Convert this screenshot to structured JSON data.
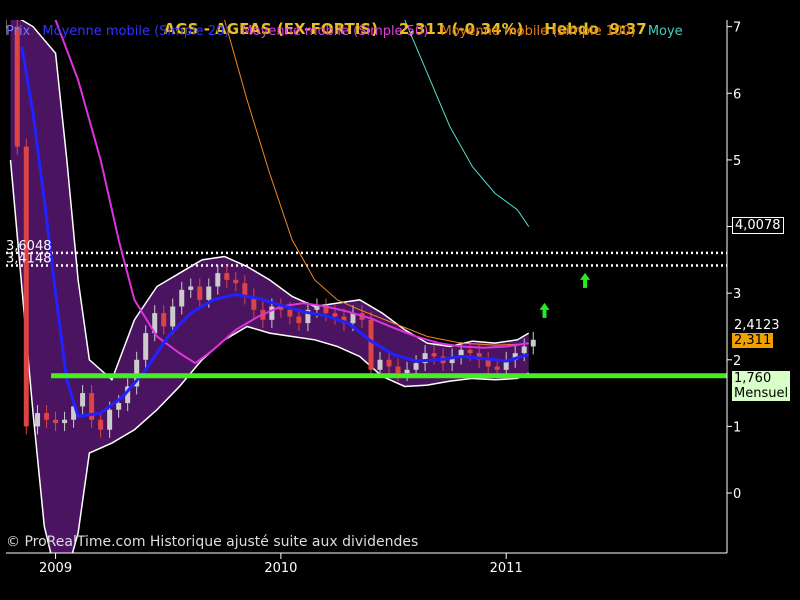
{
  "header": {
    "ticker": "AGS - AGEAS (EX-FORTIS)",
    "quote": "2,311 (-0,34%)",
    "period": "Hebdo",
    "time": "9:37"
  },
  "legend": [
    {
      "label": "Prix",
      "color": "#7777ff"
    },
    {
      "label": "Moyenne mobile (Simple 20)",
      "color": "#3333ff"
    },
    {
      "label": "Moyenne mobile (Simple 50)",
      "color": "#e040e0"
    },
    {
      "label": "Moyenne mobile (Simple 100)",
      "color": "#e08020"
    },
    {
      "label": "Moye",
      "color": "#40d0c0"
    }
  ],
  "footer": "© ProRealTime.com Historique ajusté suite aux dividendes",
  "colors": {
    "background": "#000000",
    "band_fill": "#4a1460",
    "band_edge": "#ffffff",
    "sma20": "#2222ff",
    "sma50": "#dd33dd",
    "sma100": "#ee8822",
    "sma200": "#55ddcc",
    "sma_dashed": "#44cccc",
    "support": "#44ee22",
    "arrow": "#22ee22",
    "up_candle": "#cccccc",
    "down_candle": "#dd4444",
    "price_tag": "#f0a000",
    "support_tag": "#d8ffc8"
  },
  "chart_data": {
    "type": "candlestick",
    "title": "AGS - AGEAS (EX-FORTIS)",
    "ylim": [
      -0.9,
      7.1
    ],
    "y_ticks": [
      "0",
      "1",
      "2",
      "3",
      "4",
      "5",
      "6",
      "7"
    ],
    "x_ticks": [
      "2009",
      "2010",
      "2011"
    ],
    "x_range": [
      "2008-10",
      "2011-12"
    ],
    "horizontal_levels": [
      {
        "value": 3.6048,
        "label": "3,6048",
        "style": "dotted"
      },
      {
        "value": 3.4148,
        "label": "3,4148",
        "style": "dotted"
      }
    ],
    "support": {
      "value": 1.76,
      "label": "1,760",
      "sublabel": "Mensuel"
    },
    "price_tags": [
      {
        "value": 4.0078,
        "label": "4,0078"
      },
      {
        "value": 2.311,
        "label": "2,311"
      },
      {
        "value": 2.4123,
        "label": "2,4123"
      }
    ],
    "closes": [
      [
        2008.78,
        7.0
      ],
      [
        2008.83,
        5.2
      ],
      [
        2008.87,
        1.0
      ],
      [
        2008.92,
        1.2
      ],
      [
        2008.96,
        1.1
      ],
      [
        2009.0,
        1.05
      ],
      [
        2009.04,
        1.1
      ],
      [
        2009.08,
        1.3
      ],
      [
        2009.12,
        1.5
      ],
      [
        2009.16,
        1.1
      ],
      [
        2009.2,
        0.95
      ],
      [
        2009.24,
        1.25
      ],
      [
        2009.28,
        1.35
      ],
      [
        2009.32,
        1.6
      ],
      [
        2009.36,
        2.0
      ],
      [
        2009.4,
        2.4
      ],
      [
        2009.44,
        2.7
      ],
      [
        2009.48,
        2.5
      ],
      [
        2009.52,
        2.8
      ],
      [
        2009.56,
        3.05
      ],
      [
        2009.6,
        3.1
      ],
      [
        2009.64,
        2.9
      ],
      [
        2009.68,
        3.1
      ],
      [
        2009.72,
        3.3
      ],
      [
        2009.76,
        3.2
      ],
      [
        2009.8,
        3.15
      ],
      [
        2009.84,
        2.95
      ],
      [
        2009.88,
        2.75
      ],
      [
        2009.92,
        2.6
      ],
      [
        2009.96,
        2.8
      ],
      [
        2010.0,
        2.75
      ],
      [
        2010.04,
        2.65
      ],
      [
        2010.08,
        2.55
      ],
      [
        2010.12,
        2.75
      ],
      [
        2010.16,
        2.8
      ],
      [
        2010.2,
        2.7
      ],
      [
        2010.24,
        2.65
      ],
      [
        2010.28,
        2.55
      ],
      [
        2010.32,
        2.7
      ],
      [
        2010.36,
        2.6
      ],
      [
        2010.4,
        1.85
      ],
      [
        2010.44,
        2.0
      ],
      [
        2010.48,
        1.9
      ],
      [
        2010.52,
        1.8
      ],
      [
        2010.56,
        1.85
      ],
      [
        2010.6,
        1.95
      ],
      [
        2010.64,
        2.1
      ],
      [
        2010.68,
        2.05
      ],
      [
        2010.72,
        1.95
      ],
      [
        2010.76,
        2.05
      ],
      [
        2010.8,
        2.15
      ],
      [
        2010.84,
        2.1
      ],
      [
        2010.88,
        2.0
      ],
      [
        2010.92,
        1.9
      ],
      [
        2010.96,
        1.85
      ],
      [
        2011.0,
        2.0
      ],
      [
        2011.04,
        2.1
      ],
      [
        2011.08,
        2.2
      ],
      [
        2011.12,
        2.3
      ]
    ],
    "sma20": [
      [
        2008.85,
        6.7
      ],
      [
        2008.9,
        5.7
      ],
      [
        2008.95,
        4.4
      ],
      [
        2009.0,
        3.0
      ],
      [
        2009.05,
        1.7
      ],
      [
        2009.1,
        1.15
      ],
      [
        2009.2,
        1.2
      ],
      [
        2009.3,
        1.45
      ],
      [
        2009.4,
        1.85
      ],
      [
        2009.5,
        2.35
      ],
      [
        2009.6,
        2.7
      ],
      [
        2009.7,
        2.9
      ],
      [
        2009.8,
        2.98
      ],
      [
        2009.9,
        2.92
      ],
      [
        2010.0,
        2.82
      ],
      [
        2010.1,
        2.72
      ],
      [
        2010.2,
        2.66
      ],
      [
        2010.3,
        2.55
      ],
      [
        2010.4,
        2.28
      ],
      [
        2010.5,
        2.08
      ],
      [
        2010.6,
        1.98
      ],
      [
        2010.7,
        2.0
      ],
      [
        2010.8,
        2.05
      ],
      [
        2010.9,
        2.02
      ],
      [
        2011.0,
        1.98
      ],
      [
        2011.1,
        2.08
      ]
    ],
    "sma50": [
      [
        2009.0,
        7.1
      ],
      [
        2009.1,
        6.2
      ],
      [
        2009.2,
        5.0
      ],
      [
        2009.28,
        3.8
      ],
      [
        2009.35,
        2.9
      ],
      [
        2009.45,
        2.35
      ],
      [
        2009.55,
        2.1
      ],
      [
        2009.62,
        1.95
      ],
      [
        2009.7,
        2.15
      ],
      [
        2009.8,
        2.45
      ],
      [
        2009.9,
        2.65
      ],
      [
        2010.0,
        2.8
      ],
      [
        2010.1,
        2.85
      ],
      [
        2010.2,
        2.8
      ],
      [
        2010.3,
        2.72
      ],
      [
        2010.4,
        2.62
      ],
      [
        2010.5,
        2.48
      ],
      [
        2010.6,
        2.35
      ],
      [
        2010.7,
        2.25
      ],
      [
        2010.8,
        2.2
      ],
      [
        2010.9,
        2.18
      ],
      [
        2011.0,
        2.2
      ],
      [
        2011.1,
        2.25
      ]
    ],
    "sma100": [
      [
        2009.75,
        7.1
      ],
      [
        2009.85,
        5.9
      ],
      [
        2009.95,
        4.8
      ],
      [
        2010.05,
        3.8
      ],
      [
        2010.15,
        3.2
      ],
      [
        2010.25,
        2.9
      ],
      [
        2010.35,
        2.75
      ],
      [
        2010.5,
        2.55
      ],
      [
        2010.65,
        2.35
      ],
      [
        2010.8,
        2.25
      ],
      [
        2010.95,
        2.22
      ],
      [
        2011.1,
        2.24
      ]
    ],
    "sma200": [
      [
        2010.55,
        7.1
      ],
      [
        2010.65,
        6.3
      ],
      [
        2010.75,
        5.5
      ],
      [
        2010.85,
        4.9
      ],
      [
        2010.95,
        4.5
      ],
      [
        2011.05,
        4.25
      ],
      [
        2011.1,
        4.0
      ]
    ],
    "band_upper": [
      [
        2008.8,
        7.2
      ],
      [
        2008.9,
        7.0
      ],
      [
        2009.0,
        6.6
      ],
      [
        2009.05,
        5.0
      ],
      [
        2009.1,
        3.2
      ],
      [
        2009.15,
        2.0
      ],
      [
        2009.25,
        1.7
      ],
      [
        2009.35,
        2.6
      ],
      [
        2009.45,
        3.1
      ],
      [
        2009.55,
        3.3
      ],
      [
        2009.65,
        3.5
      ],
      [
        2009.75,
        3.55
      ],
      [
        2009.85,
        3.4
      ],
      [
        2009.95,
        3.2
      ],
      [
        2010.05,
        2.95
      ],
      [
        2010.15,
        2.8
      ],
      [
        2010.25,
        2.85
      ],
      [
        2010.35,
        2.9
      ],
      [
        2010.45,
        2.7
      ],
      [
        2010.55,
        2.45
      ],
      [
        2010.65,
        2.25
      ],
      [
        2010.75,
        2.2
      ],
      [
        2010.85,
        2.28
      ],
      [
        2010.95,
        2.25
      ],
      [
        2011.05,
        2.3
      ],
      [
        2011.1,
        2.4
      ]
    ],
    "band_lower": [
      [
        2008.8,
        5.0
      ],
      [
        2008.9,
        1.2
      ],
      [
        2008.95,
        -0.5
      ],
      [
        2009.0,
        -1.2
      ],
      [
        2009.05,
        -1.2
      ],
      [
        2009.1,
        -0.6
      ],
      [
        2009.15,
        0.6
      ],
      [
        2009.25,
        0.75
      ],
      [
        2009.35,
        0.95
      ],
      [
        2009.45,
        1.25
      ],
      [
        2009.55,
        1.6
      ],
      [
        2009.65,
        2.0
      ],
      [
        2009.75,
        2.3
      ],
      [
        2009.85,
        2.5
      ],
      [
        2009.95,
        2.4
      ],
      [
        2010.05,
        2.35
      ],
      [
        2010.15,
        2.3
      ],
      [
        2010.25,
        2.2
      ],
      [
        2010.35,
        2.05
      ],
      [
        2010.45,
        1.75
      ],
      [
        2010.55,
        1.6
      ],
      [
        2010.65,
        1.62
      ],
      [
        2010.75,
        1.68
      ],
      [
        2010.85,
        1.72
      ],
      [
        2010.95,
        1.7
      ],
      [
        2011.05,
        1.72
      ],
      [
        2011.1,
        1.8
      ]
    ],
    "arrows": [
      [
        2011.17,
        2.75
      ],
      [
        2011.35,
        3.2
      ]
    ]
  }
}
